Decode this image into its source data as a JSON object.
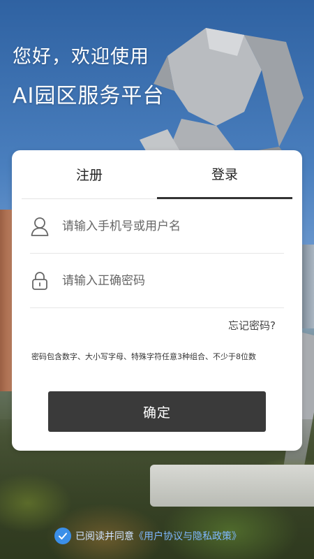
{
  "greeting": {
    "line1": "您好，欢迎使用",
    "line2": "AI园区服务平台"
  },
  "tabs": [
    {
      "label": "注册",
      "active": false
    },
    {
      "label": "登录",
      "active": true
    }
  ],
  "form": {
    "username_placeholder": "请输入手机号或用户名",
    "username_value": "",
    "password_placeholder": "请输入正确密码",
    "password_value": "",
    "username_icon": "user-icon",
    "password_icon": "lock-icon",
    "forgot_label": "忘记密码?",
    "hint": "密码包含数字、大小写字母、特殊字符任意3种组合、不少于8位数",
    "submit_label": "确定"
  },
  "agreement": {
    "checked": true,
    "prefix": "已阅读并同意",
    "link": "《用户协议与隐私政策》"
  },
  "colors": {
    "primary_button": "#3a3a3a",
    "check_accent": "#3b8fe8",
    "link": "#7fb8ff"
  }
}
